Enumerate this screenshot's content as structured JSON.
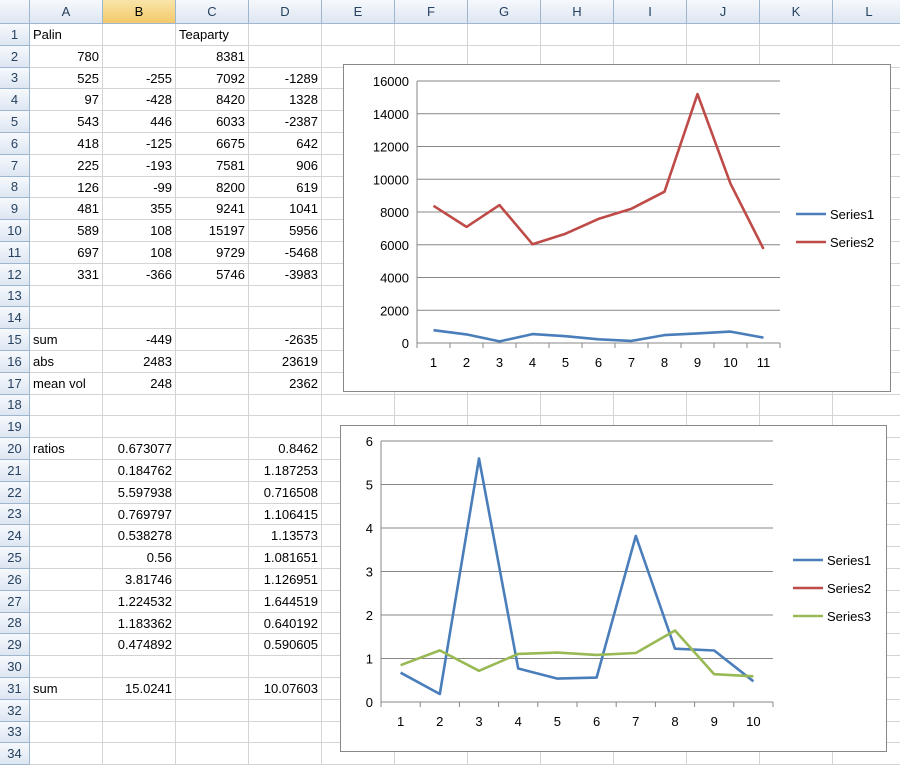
{
  "columns": [
    "A",
    "B",
    "C",
    "D",
    "E",
    "F",
    "G",
    "H",
    "I",
    "J",
    "K",
    "L"
  ],
  "selected_column": "B",
  "row_count": 34,
  "cells": [
    {
      "r": 1,
      "c": "A",
      "v": "Palin",
      "t": "txt"
    },
    {
      "r": 1,
      "c": "C",
      "v": "Teaparty",
      "t": "txt"
    },
    {
      "r": 2,
      "c": "A",
      "v": "780"
    },
    {
      "r": 2,
      "c": "C",
      "v": "8381"
    },
    {
      "r": 3,
      "c": "A",
      "v": "525"
    },
    {
      "r": 3,
      "c": "B",
      "v": "-255"
    },
    {
      "r": 3,
      "c": "C",
      "v": "7092"
    },
    {
      "r": 3,
      "c": "D",
      "v": "-1289"
    },
    {
      "r": 4,
      "c": "A",
      "v": "97"
    },
    {
      "r": 4,
      "c": "B",
      "v": "-428"
    },
    {
      "r": 4,
      "c": "C",
      "v": "8420"
    },
    {
      "r": 4,
      "c": "D",
      "v": "1328"
    },
    {
      "r": 5,
      "c": "A",
      "v": "543"
    },
    {
      "r": 5,
      "c": "B",
      "v": "446"
    },
    {
      "r": 5,
      "c": "C",
      "v": "6033"
    },
    {
      "r": 5,
      "c": "D",
      "v": "-2387"
    },
    {
      "r": 6,
      "c": "A",
      "v": "418"
    },
    {
      "r": 6,
      "c": "B",
      "v": "-125"
    },
    {
      "r": 6,
      "c": "C",
      "v": "6675"
    },
    {
      "r": 6,
      "c": "D",
      "v": "642"
    },
    {
      "r": 7,
      "c": "A",
      "v": "225"
    },
    {
      "r": 7,
      "c": "B",
      "v": "-193"
    },
    {
      "r": 7,
      "c": "C",
      "v": "7581"
    },
    {
      "r": 7,
      "c": "D",
      "v": "906"
    },
    {
      "r": 8,
      "c": "A",
      "v": "126"
    },
    {
      "r": 8,
      "c": "B",
      "v": "-99"
    },
    {
      "r": 8,
      "c": "C",
      "v": "8200"
    },
    {
      "r": 8,
      "c": "D",
      "v": "619"
    },
    {
      "r": 9,
      "c": "A",
      "v": "481"
    },
    {
      "r": 9,
      "c": "B",
      "v": "355"
    },
    {
      "r": 9,
      "c": "C",
      "v": "9241"
    },
    {
      "r": 9,
      "c": "D",
      "v": "1041"
    },
    {
      "r": 10,
      "c": "A",
      "v": "589"
    },
    {
      "r": 10,
      "c": "B",
      "v": "108"
    },
    {
      "r": 10,
      "c": "C",
      "v": "15197"
    },
    {
      "r": 10,
      "c": "D",
      "v": "5956"
    },
    {
      "r": 11,
      "c": "A",
      "v": "697"
    },
    {
      "r": 11,
      "c": "B",
      "v": "108"
    },
    {
      "r": 11,
      "c": "C",
      "v": "9729"
    },
    {
      "r": 11,
      "c": "D",
      "v": "-5468"
    },
    {
      "r": 12,
      "c": "A",
      "v": "331"
    },
    {
      "r": 12,
      "c": "B",
      "v": "-366"
    },
    {
      "r": 12,
      "c": "C",
      "v": "5746"
    },
    {
      "r": 12,
      "c": "D",
      "v": "-3983"
    },
    {
      "r": 15,
      "c": "A",
      "v": "sum",
      "t": "txt"
    },
    {
      "r": 15,
      "c": "B",
      "v": "-449"
    },
    {
      "r": 15,
      "c": "D",
      "v": "-2635"
    },
    {
      "r": 16,
      "c": "A",
      "v": "abs",
      "t": "txt"
    },
    {
      "r": 16,
      "c": "B",
      "v": "2483"
    },
    {
      "r": 16,
      "c": "D",
      "v": "23619"
    },
    {
      "r": 17,
      "c": "A",
      "v": "mean vol",
      "t": "txt"
    },
    {
      "r": 17,
      "c": "B",
      "v": "248"
    },
    {
      "r": 17,
      "c": "D",
      "v": "2362"
    },
    {
      "r": 20,
      "c": "A",
      "v": "ratios",
      "t": "txt"
    },
    {
      "r": 20,
      "c": "B",
      "v": "0.673077"
    },
    {
      "r": 20,
      "c": "D",
      "v": "0.8462"
    },
    {
      "r": 21,
      "c": "B",
      "v": "0.184762"
    },
    {
      "r": 21,
      "c": "D",
      "v": "1.187253"
    },
    {
      "r": 22,
      "c": "B",
      "v": "5.597938"
    },
    {
      "r": 22,
      "c": "D",
      "v": "0.716508"
    },
    {
      "r": 23,
      "c": "B",
      "v": "0.769797"
    },
    {
      "r": 23,
      "c": "D",
      "v": "1.106415"
    },
    {
      "r": 24,
      "c": "B",
      "v": "0.538278"
    },
    {
      "r": 24,
      "c": "D",
      "v": "1.13573"
    },
    {
      "r": 25,
      "c": "B",
      "v": "0.56"
    },
    {
      "r": 25,
      "c": "D",
      "v": "1.081651"
    },
    {
      "r": 26,
      "c": "B",
      "v": "3.81746"
    },
    {
      "r": 26,
      "c": "D",
      "v": "1.126951"
    },
    {
      "r": 27,
      "c": "B",
      "v": "1.224532"
    },
    {
      "r": 27,
      "c": "D",
      "v": "1.644519"
    },
    {
      "r": 28,
      "c": "B",
      "v": "1.183362"
    },
    {
      "r": 28,
      "c": "D",
      "v": "0.640192"
    },
    {
      "r": 29,
      "c": "B",
      "v": "0.474892"
    },
    {
      "r": 29,
      "c": "D",
      "v": "0.590605"
    },
    {
      "r": 31,
      "c": "A",
      "v": "sum",
      "t": "txt"
    },
    {
      "r": 31,
      "c": "B",
      "v": "15.0241"
    },
    {
      "r": 31,
      "c": "D",
      "v": "10.07603"
    }
  ],
  "chart_data": [
    {
      "type": "line",
      "x": [
        1,
        2,
        3,
        4,
        5,
        6,
        7,
        8,
        9,
        10,
        11
      ],
      "ylim": [
        0,
        16000
      ],
      "yticks": [
        0,
        2000,
        4000,
        6000,
        8000,
        10000,
        12000,
        14000,
        16000
      ],
      "grid": true,
      "legend": "right",
      "series": [
        {
          "name": "Series1",
          "color": "#4a7ebb",
          "values": [
            780,
            525,
            97,
            543,
            418,
            225,
            126,
            481,
            589,
            697,
            331
          ]
        },
        {
          "name": "Series2",
          "color": "#be4b48",
          "values": [
            8381,
            7092,
            8420,
            6033,
            6675,
            7581,
            8200,
            9241,
            15197,
            9729,
            5746
          ]
        }
      ]
    },
    {
      "type": "line",
      "x": [
        1,
        2,
        3,
        4,
        5,
        6,
        7,
        8,
        9,
        10
      ],
      "ylim": [
        0,
        6
      ],
      "yticks": [
        0,
        1,
        2,
        3,
        4,
        5,
        6
      ],
      "grid": true,
      "legend": "right",
      "series": [
        {
          "name": "Series1",
          "color": "#4a7ebb",
          "values": [
            0.673077,
            0.184762,
            5.597938,
            0.769797,
            0.538278,
            0.56,
            3.81746,
            1.224532,
            1.183362,
            0.474892
          ]
        },
        {
          "name": "Series2",
          "color": "#be4b48",
          "values": []
        },
        {
          "name": "Series3",
          "color": "#98b954",
          "values": [
            0.8462,
            1.187253,
            0.716508,
            1.106415,
            1.13573,
            1.081651,
            1.126951,
            1.644519,
            0.640192,
            0.590605
          ]
        }
      ]
    }
  ]
}
